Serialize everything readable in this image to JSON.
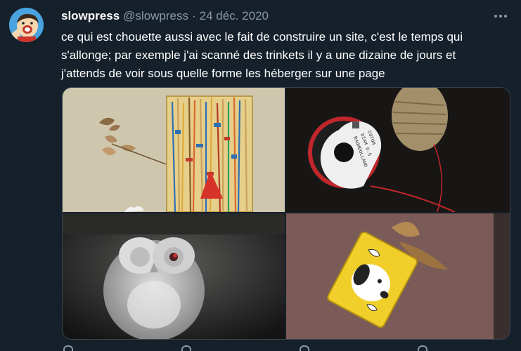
{
  "tweet": {
    "display_name": "slowpress",
    "handle": "@slowpress",
    "separator": "·",
    "date": "24 déc. 2020",
    "text_lines": [
      "ce qui est chouette aussi avec le fait de construire un site, c'est le temps qui",
      "s'allonge; par exemple j'ai scanné des trinkets il y a une dizaine de jours et",
      "j'attends de voir sous quelle forme les héberger sur une page"
    ]
  },
  "colors": {
    "background": "#15202b",
    "secondary_text": "#8899a6",
    "border": "#38444d"
  },
  "icons": {
    "more": "more-horizontal-icon",
    "reply": "reply-icon",
    "retweet": "retweet-icon",
    "like": "heart-icon",
    "share": "share-icon"
  }
}
